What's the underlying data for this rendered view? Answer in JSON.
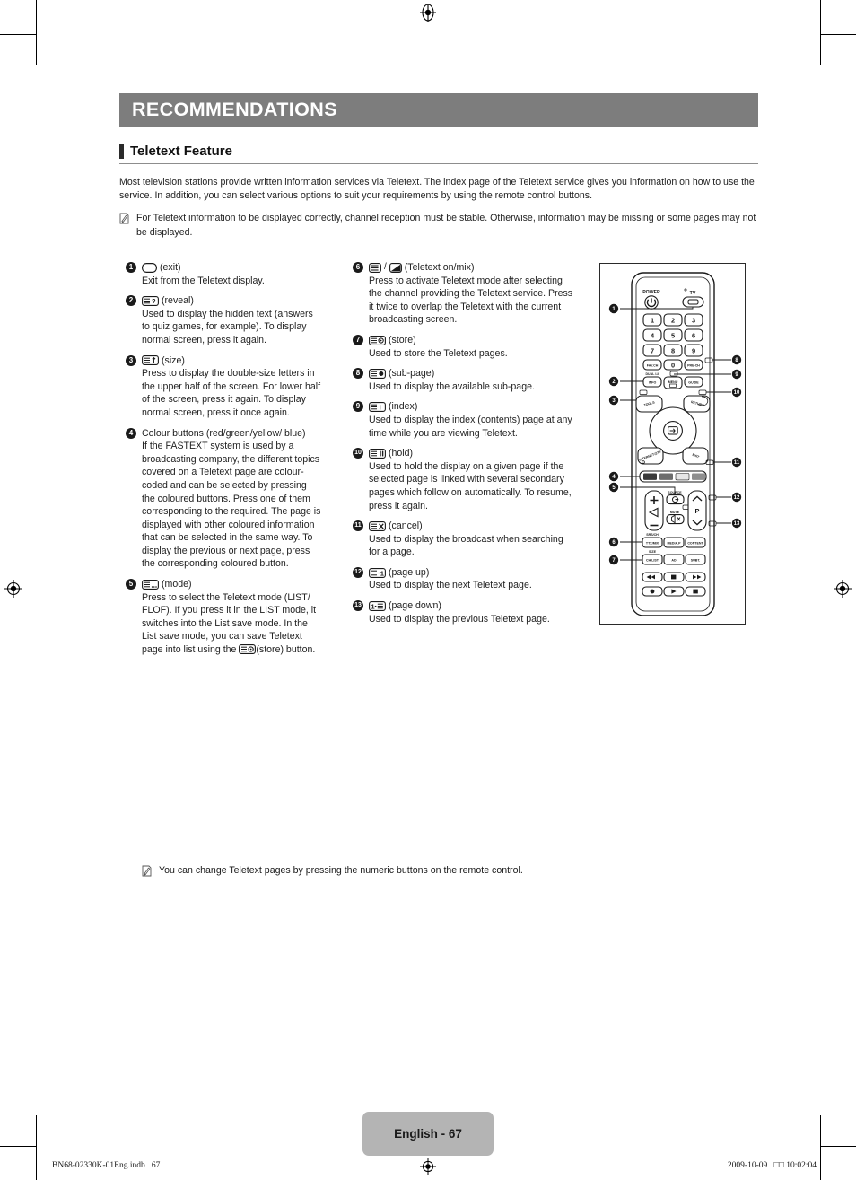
{
  "chapter": {
    "title": "RECOMMENDATIONS"
  },
  "section": {
    "title": "Teletext Feature"
  },
  "intro": {
    "paragraph": "Most television stations provide written information services via Teletext. The index page of the Teletext service gives you information on how to use the service. In addition, you can select various options to suit your requirements by using the remote control buttons.",
    "note": "For Teletext information to be displayed correctly, channel reception must be stable. Otherwise, information may be missing or some pages may not be displayed.",
    "note_icon": "note-pencil-icon"
  },
  "left_column": {
    "items": [
      {
        "num": "1",
        "icon": "exit-key-icon",
        "label": "(exit)",
        "body": "Exit from the Teletext display."
      },
      {
        "num": "2",
        "icon": "reveal-key-icon",
        "label": "(reveal)",
        "body": "Used to display the hidden text (answers to quiz games, for example). To display normal screen, press it again."
      },
      {
        "num": "3",
        "icon": "size-key-icon",
        "label": "(size)",
        "body": "Press to display the double-size letters in the upper half of the screen. For lower half of the screen, press it again. To display normal screen, press it once again."
      },
      {
        "num": "4",
        "icon": "",
        "label": "Colour buttons (red/green/yellow/ blue)",
        "body": "If the FASTEXT system is used by a broadcasting company, the different topics covered on a Teletext page are colour-coded and can be selected by pressing the coloured buttons. Press one of them corresponding to the required. The page is displayed with other coloured information that can be selected in the same way. To display the previous or next page, press the corresponding coloured button."
      },
      {
        "num": "5",
        "icon": "mode-key-icon",
        "label": "(mode)",
        "body_part1": "Press to select the Teletext mode (LIST/ FLOF). If you press it in the LIST mode, it switches into the List save mode. In the List save mode, you can save Teletext page into list using the ",
        "inline_icon": "store-key-icon",
        "body_part2": "(store) button."
      }
    ]
  },
  "right_column": {
    "items": [
      {
        "num": "6",
        "icon": "teletext-on-key-icon",
        "icon2": "teletext-mix-key-icon",
        "separator": "/",
        "label": "(Teletext on/mix)",
        "body": "Press to activate Teletext mode after selecting the channel providing the Teletext service. Press it twice to overlap the Teletext with the current broadcasting screen."
      },
      {
        "num": "7",
        "icon": "store-key-icon",
        "label": "(store)",
        "body": "Used to store the Teletext pages."
      },
      {
        "num": "8",
        "icon": "sub-page-key-icon",
        "label": "(sub-page)",
        "body": "Used to display the available sub-page."
      },
      {
        "num": "9",
        "icon": "index-key-icon",
        "label": "(index)",
        "body": "Used to display the index (contents) page at any time while you are viewing Teletext."
      },
      {
        "num": "10",
        "icon": "hold-key-icon",
        "label": "(hold)",
        "body": "Used to hold the display on a given page if the selected page is linked with several secondary pages which follow on automatically. To resume, press it again."
      },
      {
        "num": "11",
        "icon": "cancel-key-icon",
        "label": "(cancel)",
        "body": "Used to display the broadcast when searching for a page."
      },
      {
        "num": "12",
        "icon": "page-up-key-icon",
        "label": "(page up)",
        "body": "Used to display the next Teletext page."
      },
      {
        "num": "13",
        "icon": "page-down-key-icon",
        "label": "(page down)",
        "body": "Used to display the previous Teletext page."
      }
    ]
  },
  "remote": {
    "alt": "Samsung TV remote control with numbered callouts 1 to 13",
    "power_label": "POWER",
    "tv_label": "TV",
    "keys": {
      "numbers": [
        "1",
        "2",
        "3",
        "4",
        "5",
        "6",
        "7",
        "8",
        "9",
        "0"
      ],
      "fav_ch": "FAV.CH",
      "pre_ch": "PRE-CH",
      "info": "INFO",
      "info_top": "DUAL I-II",
      "menu": "MENU",
      "guide": "GUIDE",
      "tools": "TOOLS",
      "return": "RETURN",
      "internet": "INTERNET@TV",
      "exit": "EXIT",
      "source": "SOURCE",
      "mute": "MUTE",
      "p_label": "P",
      "ttxmix": "TTX/MIX",
      "ttx_top": "SRS/CH",
      "media_p": "MEDIA.P",
      "content": "CONTENT",
      "ch_list": "CH LIST",
      "ch_list_top": "SIZE",
      "ad": "AD",
      "subt": "SUBT."
    },
    "colour_buttons": [
      "red",
      "green",
      "yellow",
      "blue"
    ],
    "callouts": [
      "1",
      "2",
      "3",
      "4",
      "5",
      "6",
      "7",
      "8",
      "9",
      "10",
      "11",
      "12",
      "13"
    ]
  },
  "bottom_note": {
    "icon": "note-pencil-icon",
    "text": "You can change Teletext pages by pressing the numeric buttons on the remote control."
  },
  "footer": {
    "page_label": "English - 67",
    "file_ref": "BN68-02330K-01Eng.indb   67",
    "timestamp": "2009-10-09   □□ 10:02:04",
    "mark": "registration-mark-icon"
  },
  "colors": {
    "chapter_bar": "#7d7d7d",
    "page_tab": "#b4b4b4",
    "accent": "#2a2a2a",
    "rule": "#8d8d8d",
    "text": "#1f1f1f"
  }
}
